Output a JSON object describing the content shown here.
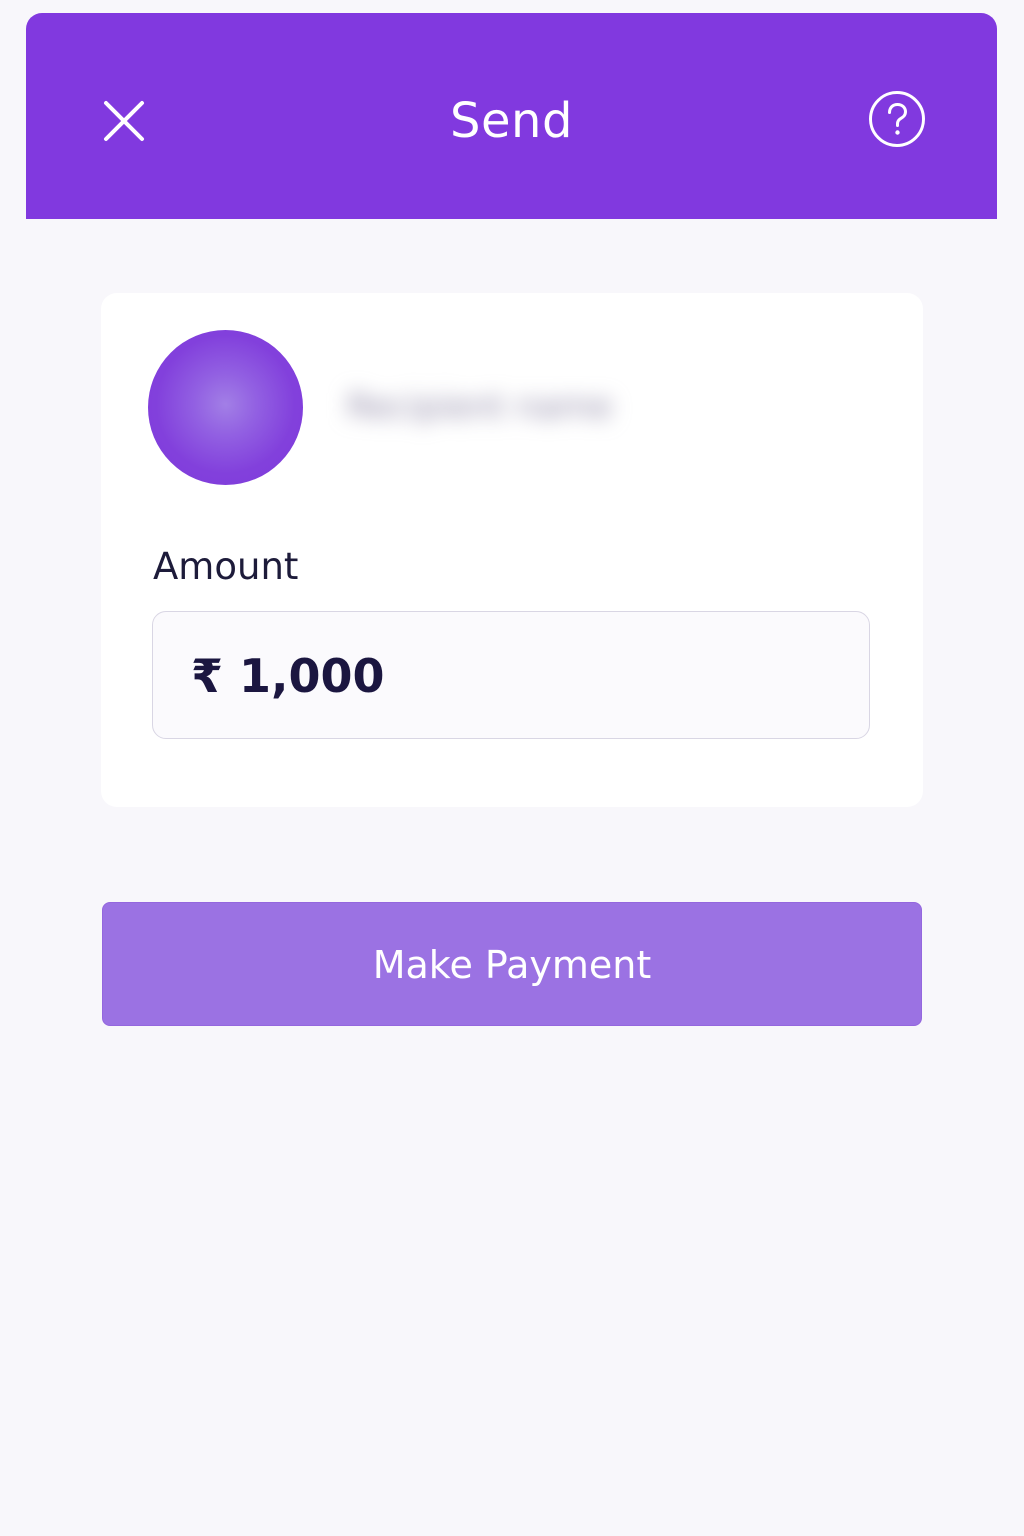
{
  "header": {
    "title": "Send",
    "close_icon": "close-icon",
    "help_icon": "help-icon"
  },
  "recipient": {
    "name": "Recipient name"
  },
  "amount": {
    "label": "Amount",
    "value": "₹ 1,000"
  },
  "actions": {
    "pay_label": "Make Payment"
  },
  "colors": {
    "brand": "#8139df",
    "button": "#9b72e3",
    "background": "#f8f7fb",
    "card": "#ffffff",
    "text_dark": "#1b1640"
  }
}
